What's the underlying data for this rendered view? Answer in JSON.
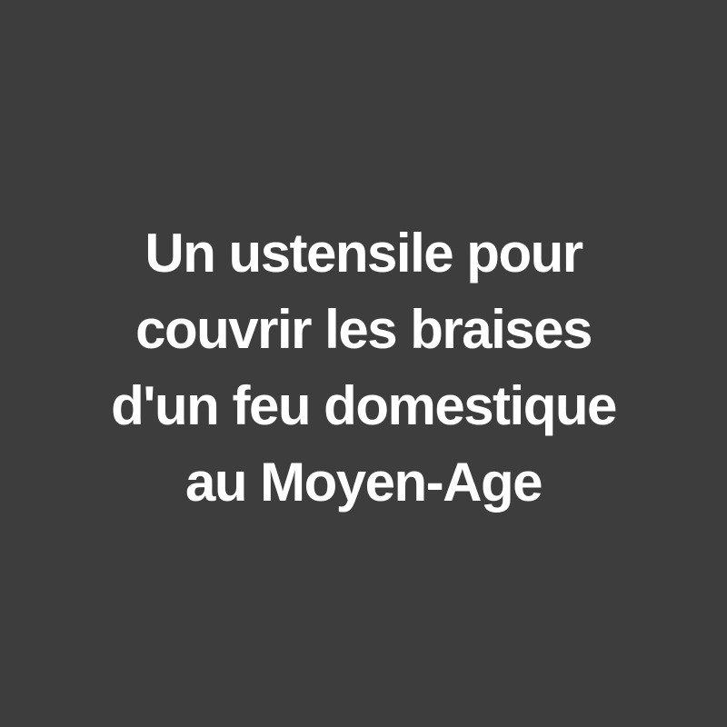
{
  "caption": {
    "lines": [
      "Un ustensile pour",
      "couvrir les braises",
      "d'un feu domestique",
      "au Moyen-Age"
    ]
  },
  "colors": {
    "background": "#3d3d3d",
    "text": "#ffffff"
  }
}
